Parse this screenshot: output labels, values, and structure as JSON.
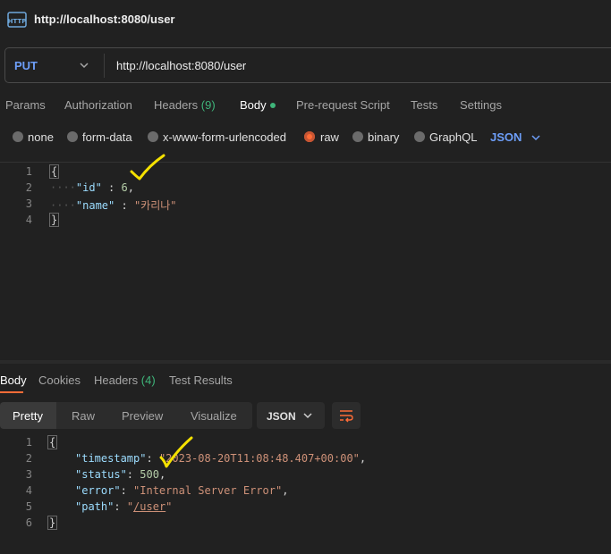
{
  "window": {
    "title": "http://localhost:8080/user",
    "icon": "http-icon"
  },
  "request": {
    "method": "PUT",
    "url": "http://localhost:8080/user",
    "tabs": {
      "params": "Params",
      "authorization": "Authorization",
      "headers_label": "Headers",
      "headers_count": "(9)",
      "body": "Body",
      "prerequest": "Pre-request Script",
      "tests": "Tests",
      "settings": "Settings"
    },
    "body_types": {
      "none": "none",
      "form_data": "form-data",
      "urlencoded": "x-www-form-urlencoded",
      "raw": "raw",
      "binary": "binary",
      "graphql": "GraphQL",
      "selected": "raw"
    },
    "language": "JSON",
    "editor": {
      "line_numbers": [
        "1",
        "2",
        "3",
        "4"
      ],
      "open_brace": "{",
      "close_brace": "}",
      "ws1": "····",
      "ws2": "····",
      "key1": "\"id\"",
      "sep1": " : ",
      "val1": "6",
      "comma1": ",",
      "key2": "\"name\"",
      "sep2": " : ",
      "val2": "\"카리나\""
    }
  },
  "response": {
    "tabs": {
      "body": "Body",
      "cookies": "Cookies",
      "headers_label": "Headers",
      "headers_count": "(4)",
      "test_results": "Test Results"
    },
    "views": {
      "pretty": "Pretty",
      "raw": "Raw",
      "preview": "Preview",
      "visualize": "Visualize"
    },
    "format": "JSON",
    "editor": {
      "line_numbers": [
        "1",
        "2",
        "3",
        "4",
        "5",
        "6"
      ],
      "open_brace": "{",
      "close_brace": "}",
      "key1": "\"timestamp\"",
      "val1": "\"2023-08-20T11:08:48.407+00:00\"",
      "key2": "\"status\"",
      "val2": "500",
      "key3": "\"error\"",
      "val3": "\"Internal Server Error\"",
      "key4": "\"path\"",
      "val4_q": "\"",
      "val4_path": "/user",
      "colon": ": ",
      "comma": ","
    }
  },
  "colors": {
    "accent": "#ff6c37",
    "link": "#6d9ef8",
    "count": "#3fb57a",
    "annotation": "#f5e100"
  }
}
